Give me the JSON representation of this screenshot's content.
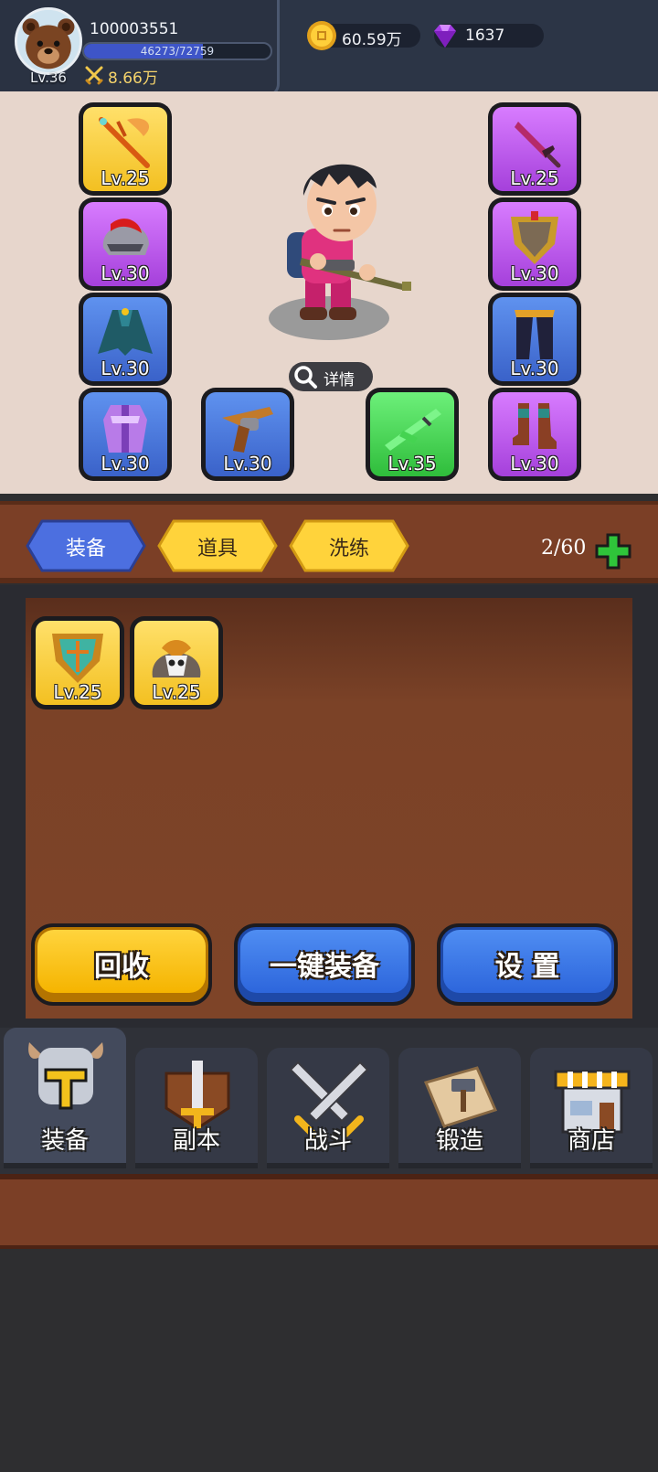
{
  "player": {
    "id": "100003551",
    "level": "Lv.36",
    "exp_text": "46273/72759",
    "exp_fraction": 0.636,
    "power": "8.66万"
  },
  "currency": {
    "gold": "60.59万",
    "gems": "1637"
  },
  "equipment": {
    "slots": [
      {
        "item": "orange-scepter",
        "rarity": "gold",
        "level": "Lv.25"
      },
      {
        "item": "red-helmet",
        "rarity": "purple",
        "level": "Lv.30"
      },
      {
        "item": "teal-cloak",
        "rarity": "blue",
        "level": "Lv.30"
      },
      {
        "item": "purple-armor",
        "rarity": "blue",
        "level": "Lv.30"
      },
      {
        "item": "revolver",
        "rarity": "blue",
        "level": "Lv.30"
      },
      {
        "item": "green-rifle",
        "rarity": "green",
        "level": "Lv.35"
      },
      {
        "item": "dagger",
        "rarity": "purple",
        "level": "Lv.25"
      },
      {
        "item": "golden-shield",
        "rarity": "purple",
        "level": "Lv.30"
      },
      {
        "item": "dark-pants",
        "rarity": "blue",
        "level": "Lv.30"
      },
      {
        "item": "boots",
        "rarity": "purple",
        "level": "Lv.30"
      }
    ],
    "details_label": "详情"
  },
  "tabs": [
    {
      "label": "装备",
      "active": true
    },
    {
      "label": "道具",
      "active": false
    },
    {
      "label": "洗练",
      "active": false
    }
  ],
  "inventory": {
    "count": "2/60",
    "items": [
      {
        "item": "green-shield",
        "rarity": "gold",
        "level": "Lv.25"
      },
      {
        "item": "skull-helmet",
        "rarity": "gold",
        "level": "Lv.25"
      }
    ]
  },
  "actions": {
    "recycle": "回收",
    "equip_all": "一键装备",
    "settings": "设 置"
  },
  "nav": [
    {
      "label": "装备",
      "icon": "armor-icon",
      "active": true
    },
    {
      "label": "副本",
      "icon": "sword-shield-icon",
      "active": false
    },
    {
      "label": "战斗",
      "icon": "crossed-swords-icon",
      "active": false
    },
    {
      "label": "锻造",
      "icon": "forge-scroll-icon",
      "active": false
    },
    {
      "label": "商店",
      "icon": "shop-icon",
      "active": false
    }
  ],
  "colors": {
    "gold_rarity": "#f3c021",
    "purple_rarity": "#a540db",
    "blue_rarity": "#3a62c9",
    "green_rarity": "#2fbd3b",
    "brown_panel": "#7b3f26"
  }
}
